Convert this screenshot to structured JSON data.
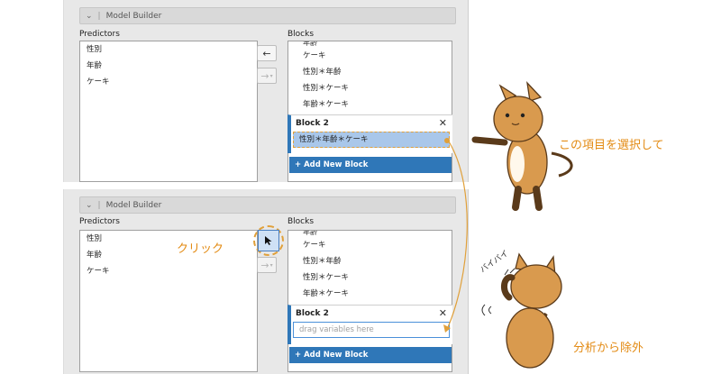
{
  "panel": {
    "header": "Model Builder",
    "predictors_label": "Predictors",
    "blocks_label": "Blocks",
    "predictors": [
      "性別",
      "年齢",
      "ケーキ"
    ],
    "blocks_cut_item": "年齢",
    "blocks_items": [
      "ケーキ",
      "性別＊年齢",
      "性別＊ケーキ",
      "年齢＊ケーキ"
    ],
    "block2_title": "Block 2",
    "block2_close": "✕",
    "selected_item": "性別＊年齢＊ケーキ",
    "drag_placeholder": "drag variables here",
    "add_block_label": "Add New Block",
    "add_block_plus": "+",
    "arrow_left": "←",
    "arrow_right": "→"
  },
  "annotations": {
    "select_text": "この項目を選択して",
    "click_text": "クリック",
    "remove_text": "分析から除外",
    "byebye_text": "バイバイ"
  },
  "colors": {
    "accent_blue": "#2f77b8",
    "highlight": "#a9c7ea",
    "annotation_orange": "#e38b14"
  }
}
